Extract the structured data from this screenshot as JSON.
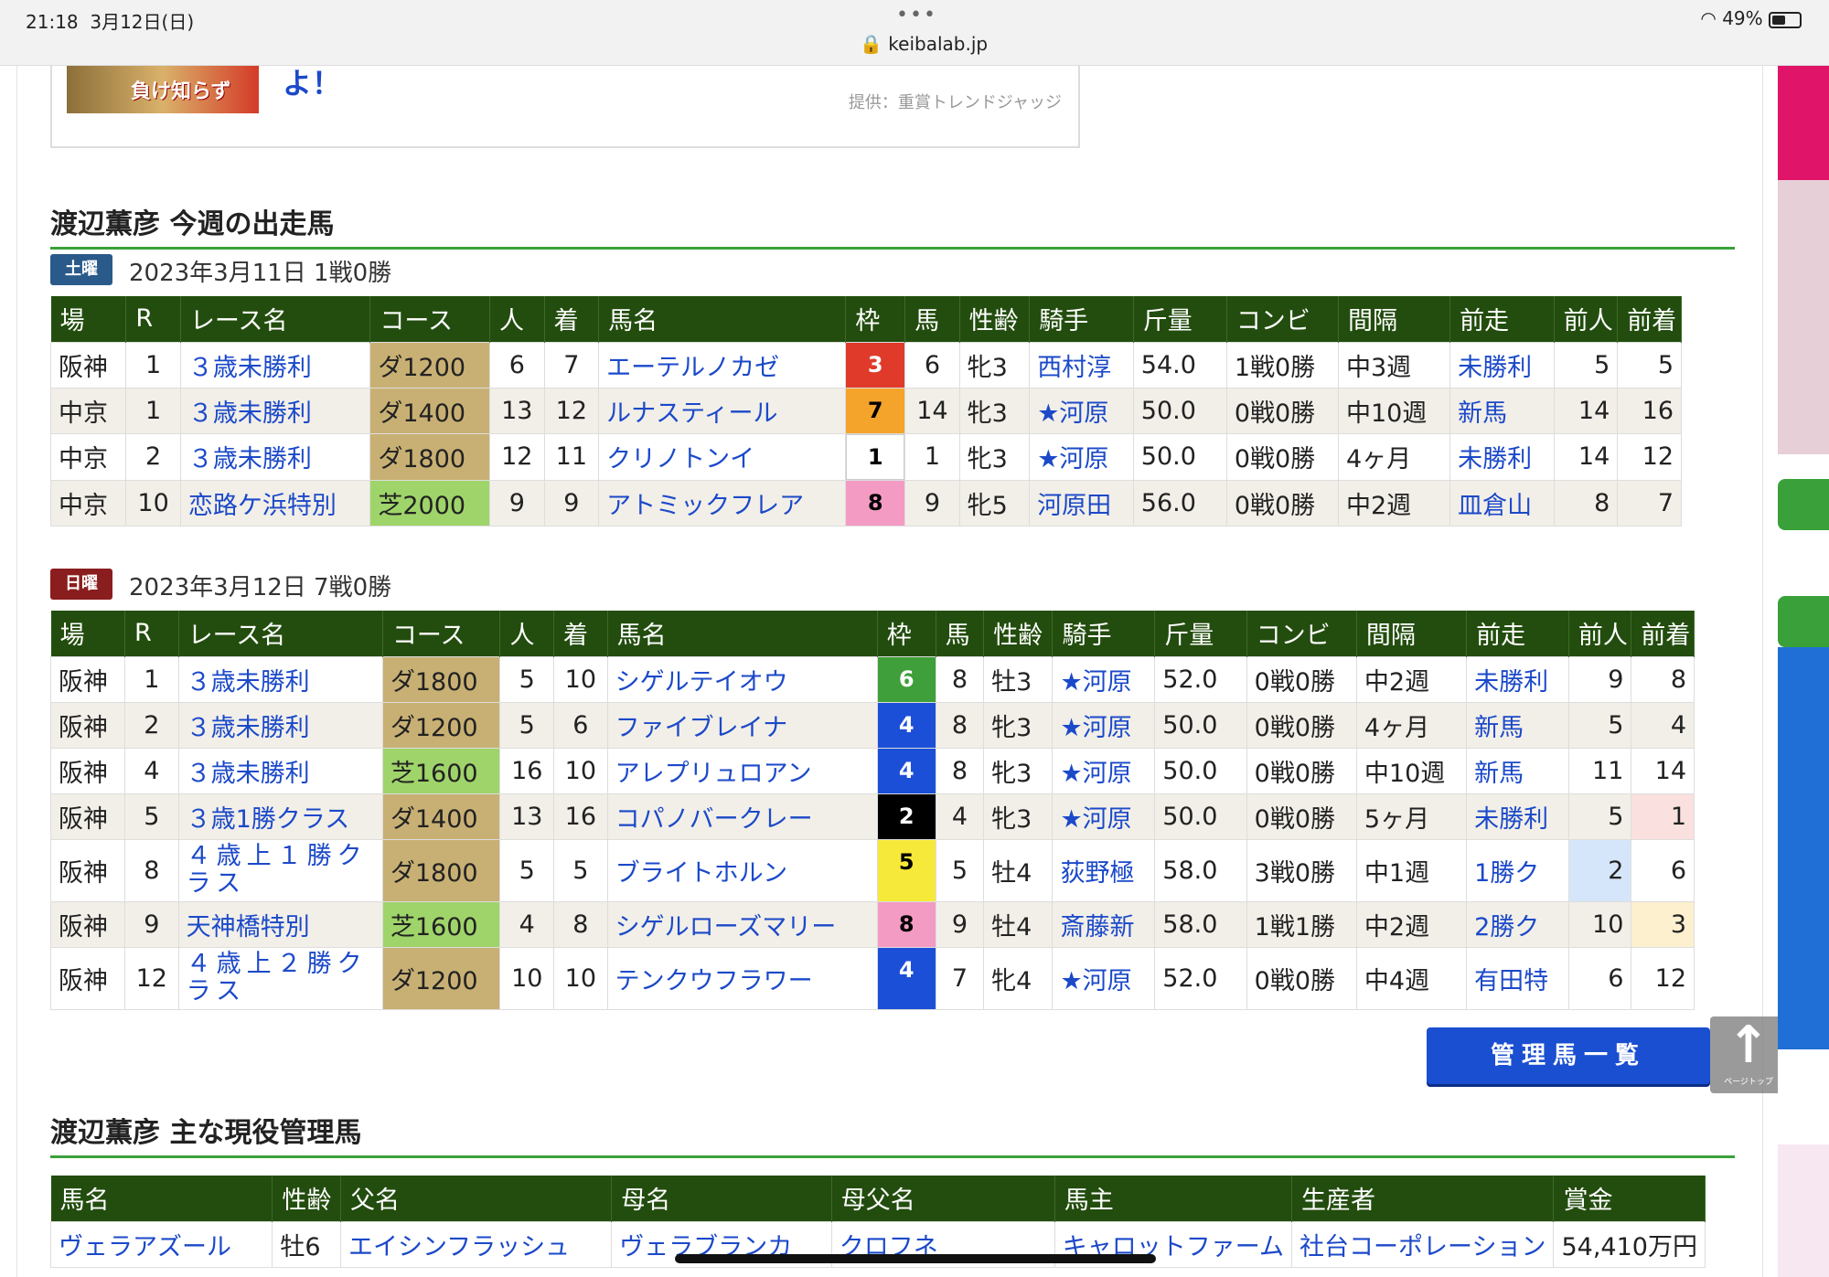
{
  "status_bar": {
    "time": "21:18",
    "date": "3月12日(日)",
    "url": "keibalab.jp",
    "battery": "49%"
  },
  "promo": {
    "banner_text": "負け知らず",
    "headline_tail": "よ！",
    "credit": "提供：重賞トレンドジャッジ"
  },
  "this_week": {
    "title": "渡辺薫彦 今週の出走馬",
    "columns": [
      "場",
      "R",
      "レース名",
      "コース",
      "人",
      "着",
      "馬名",
      "枠",
      "馬",
      "性齢",
      "騎手",
      "斤量",
      "コンビ",
      "間隔",
      "前走",
      "前人",
      "前着"
    ],
    "saturday": {
      "badge": "土曜",
      "label": "2023年3月11日 1戦0勝",
      "rows": [
        {
          "track": "阪神",
          "r": "1",
          "race": "３歳未勝利",
          "course": "ダ1200",
          "pop": "6",
          "finish": "7",
          "horse": "エーテルノカゼ",
          "waku": "3",
          "num": "6",
          "sex_age": "牝3",
          "jockey": "西村淳",
          "weight": "54.0",
          "combi": "1戦0勝",
          "interval": "中3週",
          "prev": "未勝利",
          "prev_pop": "5",
          "prev_finish": "5"
        },
        {
          "track": "中京",
          "r": "1",
          "race": "３歳未勝利",
          "course": "ダ1400",
          "pop": "13",
          "finish": "12",
          "horse": "ルナスティール",
          "waku": "7",
          "num": "14",
          "sex_age": "牝3",
          "jockey": "★河原",
          "weight": "50.0",
          "combi": "0戦0勝",
          "interval": "中10週",
          "prev": "新馬",
          "prev_pop": "14",
          "prev_finish": "16"
        },
        {
          "track": "中京",
          "r": "2",
          "race": "３歳未勝利",
          "course": "ダ1800",
          "pop": "12",
          "finish": "11",
          "horse": "クリノトンイ",
          "waku": "1",
          "num": "1",
          "sex_age": "牝3",
          "jockey": "★河原",
          "weight": "50.0",
          "combi": "0戦0勝",
          "interval": "4ヶ月",
          "prev": "未勝利",
          "prev_pop": "14",
          "prev_finish": "12"
        },
        {
          "track": "中京",
          "r": "10",
          "race": "恋路ケ浜特別",
          "course": "芝2000",
          "pop": "9",
          "finish": "9",
          "horse": "アトミックフレア",
          "waku": "8",
          "num": "9",
          "sex_age": "牝5",
          "jockey": "河原田",
          "weight": "56.0",
          "combi": "0戦0勝",
          "interval": "中2週",
          "prev": "皿倉山",
          "prev_pop": "8",
          "prev_finish": "7"
        }
      ]
    },
    "sunday": {
      "badge": "日曜",
      "label": "2023年3月12日 7戦0勝",
      "rows": [
        {
          "track": "阪神",
          "r": "1",
          "race": "３歳未勝利",
          "course": "ダ1800",
          "pop": "5",
          "finish": "10",
          "horse": "シゲルテイオウ",
          "waku": "6",
          "num": "8",
          "sex_age": "牡3",
          "jockey": "★河原",
          "weight": "52.0",
          "combi": "0戦0勝",
          "interval": "中2週",
          "prev": "未勝利",
          "prev_pop": "9",
          "prev_finish": "8"
        },
        {
          "track": "阪神",
          "r": "2",
          "race": "３歳未勝利",
          "course": "ダ1200",
          "pop": "5",
          "finish": "6",
          "horse": "ファイブレイナ",
          "waku": "4",
          "num": "8",
          "sex_age": "牝3",
          "jockey": "★河原",
          "weight": "50.0",
          "combi": "0戦0勝",
          "interval": "4ヶ月",
          "prev": "新馬",
          "prev_pop": "5",
          "prev_finish": "4"
        },
        {
          "track": "阪神",
          "r": "4",
          "race": "３歳未勝利",
          "course": "芝1600",
          "pop": "16",
          "finish": "10",
          "horse": "アレプリュロアン",
          "waku": "4",
          "num": "8",
          "sex_age": "牝3",
          "jockey": "★河原",
          "weight": "50.0",
          "combi": "0戦0勝",
          "interval": "中10週",
          "prev": "新馬",
          "prev_pop": "11",
          "prev_finish": "14"
        },
        {
          "track": "阪神",
          "r": "5",
          "race": "３歳1勝クラス",
          "course": "ダ1400",
          "pop": "13",
          "finish": "16",
          "horse": "コパノバークレー",
          "waku": "2",
          "num": "4",
          "sex_age": "牝3",
          "jockey": "★河原",
          "weight": "50.0",
          "combi": "0戦0勝",
          "interval": "5ヶ月",
          "prev": "未勝利",
          "prev_pop": "5",
          "prev_finish": "1"
        },
        {
          "track": "阪神",
          "r": "8",
          "race": "４歳上１勝クラス",
          "course": "ダ1800",
          "pop": "5",
          "finish": "5",
          "horse": "ブライトホルン",
          "waku": "5",
          "num": "5",
          "sex_age": "牡4",
          "jockey": "荻野極",
          "weight": "58.0",
          "combi": "3戦0勝",
          "interval": "中1週",
          "prev": "1勝ク",
          "prev_pop": "2",
          "prev_finish": "6"
        },
        {
          "track": "阪神",
          "r": "9",
          "race": "天神橋特別",
          "course": "芝1600",
          "pop": "4",
          "finish": "8",
          "horse": "シゲルローズマリー",
          "waku": "8",
          "num": "9",
          "sex_age": "牡4",
          "jockey": "斎藤新",
          "weight": "58.0",
          "combi": "1戦1勝",
          "interval": "中2週",
          "prev": "2勝ク",
          "prev_pop": "10",
          "prev_finish": "3"
        },
        {
          "track": "阪神",
          "r": "12",
          "race": "４歳上２勝クラス",
          "course": "ダ1200",
          "pop": "10",
          "finish": "10",
          "horse": "テンクウフラワー",
          "waku": "4",
          "num": "7",
          "sex_age": "牝4",
          "jockey": "★河原",
          "weight": "52.0",
          "combi": "0戦0勝",
          "interval": "中4週",
          "prev": "有田特",
          "prev_pop": "6",
          "prev_finish": "12"
        }
      ]
    }
  },
  "managed": {
    "title": "渡辺薫彦 主な現役管理馬",
    "button_label": "管理馬一覧",
    "columns": [
      "馬名",
      "性齢",
      "父名",
      "母名",
      "母父名",
      "馬主",
      "生産者",
      "賞金"
    ],
    "rows": [
      {
        "horse": "ヴェラアズール",
        "sex_age": "牡6",
        "sire": "エイシンフラッシュ",
        "dam": "ヴェラブランカ",
        "dam_sire": "クロフネ",
        "owner": "キャロットファーム",
        "breeder": "社台コーポレーション",
        "prize": "54,410万円"
      }
    ]
  },
  "page_top": {
    "label": "ページトップ"
  },
  "colors": {
    "header_green": "#234d0e",
    "rule_green": "#3aa13a",
    "link_blue": "#1b49c9",
    "dirt": "#c8b074",
    "turf": "#9fd46a",
    "sat_badge": "#2a5a8a",
    "sun_badge": "#8a1e1e"
  },
  "waku_colors": {
    "1": [
      "#ffffff",
      "#000000"
    ],
    "2": [
      "#000000",
      "#ffffff"
    ],
    "3": [
      "#e03a2a",
      "#ffffff"
    ],
    "4": [
      "#1c4fd8",
      "#ffffff"
    ],
    "5": [
      "#f7e93a",
      "#000000"
    ],
    "6": [
      "#3f9f3a",
      "#ffffff"
    ],
    "7": [
      "#f4a42a",
      "#000000"
    ],
    "8": [
      "#f49bc4",
      "#000000"
    ]
  }
}
